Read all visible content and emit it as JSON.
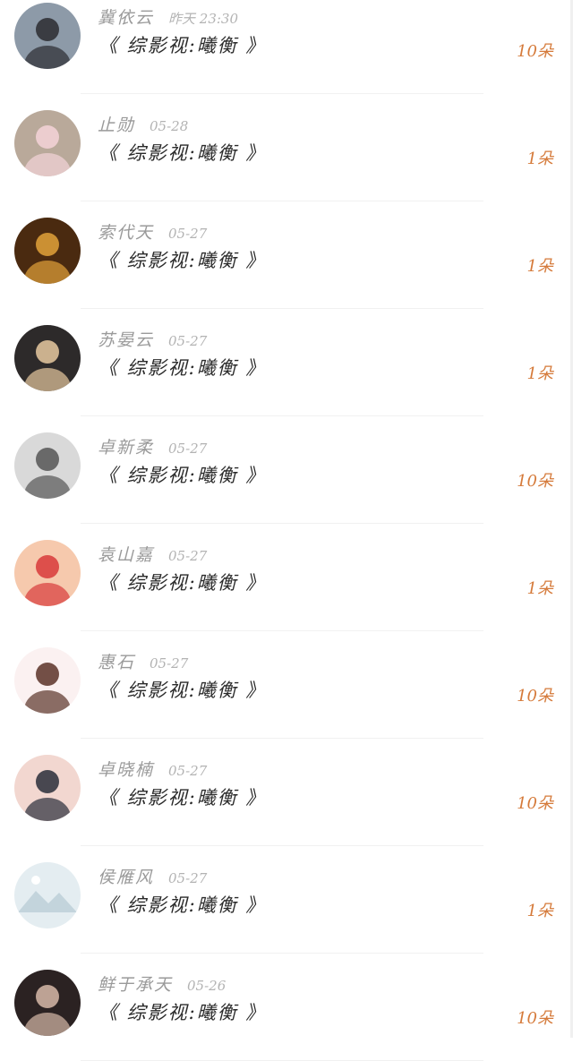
{
  "gifts": [
    {
      "name": "冀依云",
      "time": "昨天 23:30",
      "gift": "《 综影视:曦衡 》",
      "amount": "10朵",
      "avatar": {
        "icon": "avatar-photo-icon",
        "bg": "#8d9aa8",
        "fg": "#2b2b30"
      }
    },
    {
      "name": "止勋",
      "time": "05-28",
      "gift": "《 综影视:曦衡 》",
      "amount": "1朵",
      "avatar": {
        "icon": "avatar-photo-icon",
        "bg": "#b9a99a",
        "fg": "#f4d4d8"
      }
    },
    {
      "name": "索代天",
      "time": "05-27",
      "gift": "《 综影视:曦衡 》",
      "amount": "1朵",
      "avatar": {
        "icon": "avatar-photo-icon",
        "bg": "#4a2a10",
        "fg": "#e2a23a"
      }
    },
    {
      "name": "苏晏云",
      "time": "05-27",
      "gift": "《 综影视:曦衡 》",
      "amount": "1朵",
      "avatar": {
        "icon": "avatar-illustration-icon",
        "bg": "#2d2a2a",
        "fg": "#e7c9a0"
      }
    },
    {
      "name": "卓新柔",
      "time": "05-27",
      "gift": "《 综影视:曦衡 》",
      "amount": "10朵",
      "avatar": {
        "icon": "avatar-photo-icon",
        "bg": "#d9d9d9",
        "fg": "#555555"
      }
    },
    {
      "name": "袁山嘉",
      "time": "05-27",
      "gift": "《 综影视:曦衡 》",
      "amount": "1朵",
      "avatar": {
        "icon": "avatar-illustration-icon",
        "bg": "#f6c9ad",
        "fg": "#d83a3a"
      }
    },
    {
      "name": "惠石",
      "time": "05-27",
      "gift": "《 综影视:曦衡 》",
      "amount": "10朵",
      "avatar": {
        "icon": "avatar-illustration-icon",
        "bg": "#fbf1f1",
        "fg": "#5a3328"
      }
    },
    {
      "name": "卓晓楠",
      "time": "05-27",
      "gift": "《 综影视:曦衡 》",
      "amount": "10朵",
      "avatar": {
        "icon": "avatar-illustration-icon",
        "bg": "#f2d7d0",
        "fg": "#2a2e3a"
      }
    },
    {
      "name": "侯雁风",
      "time": "05-27",
      "gift": "《 综影视:曦衡 》",
      "amount": "1朵",
      "avatar": {
        "icon": "image-unavailable-icon",
        "bg": "#e4edf1",
        "fg": "#c3d4dc"
      }
    },
    {
      "name": "鲜于承天",
      "time": "05-26",
      "gift": "《 综影视:曦衡 》",
      "amount": "10朵",
      "avatar": {
        "icon": "avatar-photo-icon",
        "bg": "#2b2222",
        "fg": "#d7b9a8"
      }
    }
  ]
}
